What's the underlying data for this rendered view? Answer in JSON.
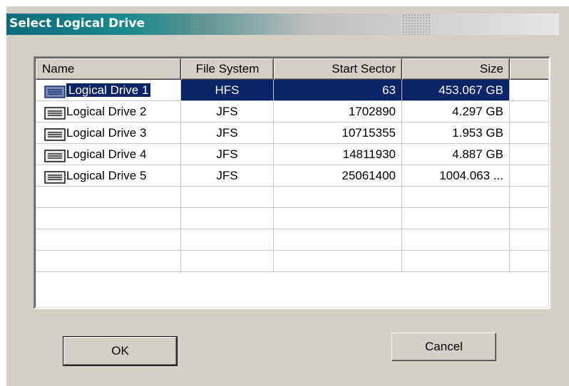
{
  "dialog": {
    "title": "Select Logical Drive",
    "ok_label": "OK",
    "cancel_label": "Cancel"
  },
  "table": {
    "columns": [
      "Name",
      "File System",
      "Start Sector",
      "Size"
    ],
    "rows": [
      {
        "name": "Logical Drive 1",
        "fs": "HFS",
        "start": "63",
        "size": "453.067 GB",
        "selected": true
      },
      {
        "name": "Logical Drive 2",
        "fs": "JFS",
        "start": "1702890",
        "size": "4.297 GB",
        "selected": false
      },
      {
        "name": "Logical Drive 3",
        "fs": "JFS",
        "start": "10715355",
        "size": "1.953 GB",
        "selected": false
      },
      {
        "name": "Logical Drive 4",
        "fs": "JFS",
        "start": "14811930",
        "size": "4.887 GB",
        "selected": false
      },
      {
        "name": "Logical Drive 5",
        "fs": "JFS",
        "start": "25061400",
        "size": "1004.063 ...",
        "selected": false
      }
    ],
    "row_icon": "drive-icon"
  },
  "colors": {
    "selection": "#0a246a",
    "dialog_bg": "#d4d0c8",
    "title_start": "#0a6b7a"
  }
}
